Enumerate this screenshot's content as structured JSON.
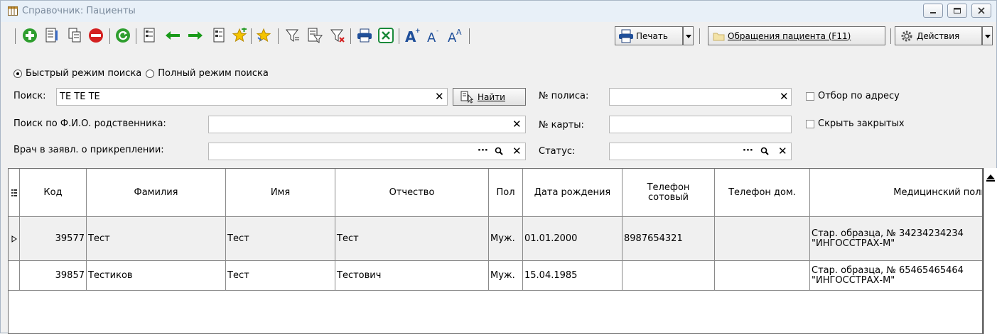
{
  "window": {
    "title": "Справочник: Пациенты"
  },
  "toolbar": {
    "print_label": "Печать",
    "appeals_label": "Обращения пациента (F11)",
    "actions_label": "Действия"
  },
  "search_modes": {
    "quick": "Быстрый режим поиска",
    "full": "Полный режим поиска",
    "selected": "quick"
  },
  "filters": {
    "search_label": "Поиск:",
    "search_value": "ТЕ ТЕ ТЕ",
    "find_label": "Найти",
    "relative_label": "Поиск по Ф.И.О. родственника:",
    "relative_value": "",
    "doctor_label": "Врач в заявл. о прикреплении:",
    "doctor_value": "",
    "policy_label": "№ полиса:",
    "policy_value": "",
    "card_label": "№ карты:",
    "card_value": "",
    "status_label": "Статус:",
    "status_value": "",
    "address_filter_label": "Отбор по адресу",
    "hide_closed_label": "Скрыть закрытых"
  },
  "table": {
    "headers": {
      "code": "Код",
      "last_name": "Фамилия",
      "first_name": "Имя",
      "patronymic": "Отчество",
      "sex": "Пол",
      "birth_date": "Дата рождения",
      "mobile": "Телефон сотовый",
      "home_phone": "Телефон дом.",
      "policy": "Медицинский поли"
    },
    "rows": [
      {
        "code": "39577",
        "last_name": "Тест",
        "first_name": "Тест",
        "patronymic": "Тест",
        "sex": "Муж.",
        "birth_date": "01.01.2000",
        "mobile": "8987654321",
        "home_phone": "",
        "policy_line1": "Стар. образца, № 34234234234",
        "policy_line2": "\"ИНГОССТРАХ-М\""
      },
      {
        "code": "39857",
        "last_name": "Тестиков",
        "first_name": "Тест",
        "patronymic": "Тестович",
        "sex": "Муж.",
        "birth_date": "15.04.1985",
        "mobile": "",
        "home_phone": "",
        "policy_line1": "Стар. образца, № 65465465464",
        "policy_line2": "\"ИНГОССТРАХ-М\""
      }
    ]
  },
  "colors": {
    "titlebar": "#e8f0f8",
    "window_bg": "#f0f0f0",
    "add_green": "#2e9e2e",
    "stop_red": "#d42020",
    "arrow_green": "#1a9a1a",
    "star_yellow": "#f5c400"
  }
}
